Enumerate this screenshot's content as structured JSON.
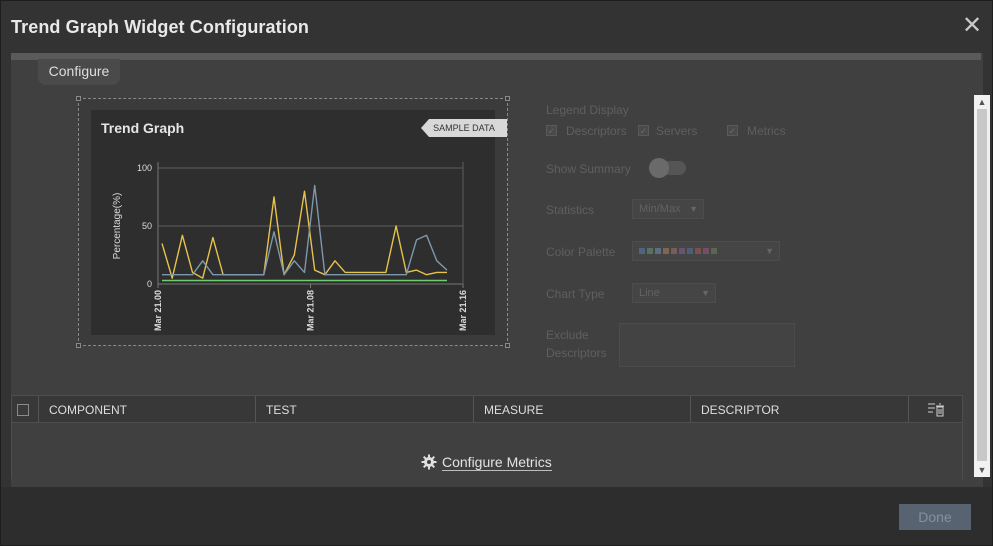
{
  "window": {
    "title": "Trend Graph Widget Configuration",
    "close_glyph": "✕"
  },
  "tabs": [
    {
      "label": "Configure"
    }
  ],
  "preview": {
    "title": "Trend Graph",
    "badge": "SAMPLE DATA"
  },
  "options": {
    "legend_display": {
      "label": "Legend Display",
      "items": [
        {
          "label": "Descriptors",
          "checked": true
        },
        {
          "label": "Servers",
          "checked": true
        },
        {
          "label": "Metrics",
          "checked": true
        }
      ]
    },
    "show_summary": {
      "label": "Show Summary",
      "on": false
    },
    "statistics": {
      "label": "Statistics",
      "value": "Min/Max"
    },
    "color_palette": {
      "label": "Color Palette",
      "colors": [
        "#5b8cc0",
        "#6aa88a",
        "#7aa0c8",
        "#c98b5b",
        "#b07a7a",
        "#8a6aa8",
        "#5a7ab0",
        "#c05b5b",
        "#a85b8a",
        "#7a8a5b"
      ]
    },
    "chart_type": {
      "label": "Chart Type",
      "value": "Line"
    },
    "exclude_descriptors": {
      "label_line1": "Exclude",
      "label_line2": "Descriptors",
      "value": ""
    }
  },
  "grid": {
    "columns": [
      "COMPONENT",
      "TEST",
      "MEASURE",
      "DESCRIPTOR"
    ],
    "configure_link": "Configure Metrics"
  },
  "footer": {
    "done_label": "Done"
  },
  "chart_data": {
    "type": "line",
    "title": "Trend Graph",
    "ylabel": "Percentage(%)",
    "ylim": [
      0,
      100
    ],
    "yticks": [
      0,
      50,
      100
    ],
    "xtick_labels": [
      "Mar 21.00",
      "Mar 21.08",
      "Mar 21.16"
    ],
    "grid": true,
    "series": [
      {
        "color": "#e6c34a",
        "values": [
          35,
          5,
          42,
          10,
          5,
          40,
          8,
          8,
          8,
          8,
          8,
          75,
          8,
          25,
          80,
          12,
          8,
          20,
          10,
          10,
          10,
          10,
          10,
          50,
          10,
          12,
          8,
          10,
          10
        ]
      },
      {
        "color": "#7f97ad",
        "values": [
          8,
          8,
          8,
          8,
          20,
          8,
          8,
          8,
          8,
          8,
          8,
          45,
          8,
          20,
          10,
          85,
          8,
          8,
          8,
          8,
          8,
          8,
          8,
          8,
          8,
          38,
          42,
          20,
          12
        ]
      },
      {
        "color": "#6fcf6f",
        "values": [
          3,
          3,
          3,
          3,
          3,
          3,
          3,
          3,
          3,
          3,
          3,
          3,
          3,
          3,
          3,
          3,
          3,
          3,
          3,
          3,
          3,
          3,
          3,
          3,
          3,
          3,
          3,
          3,
          3
        ]
      }
    ]
  }
}
